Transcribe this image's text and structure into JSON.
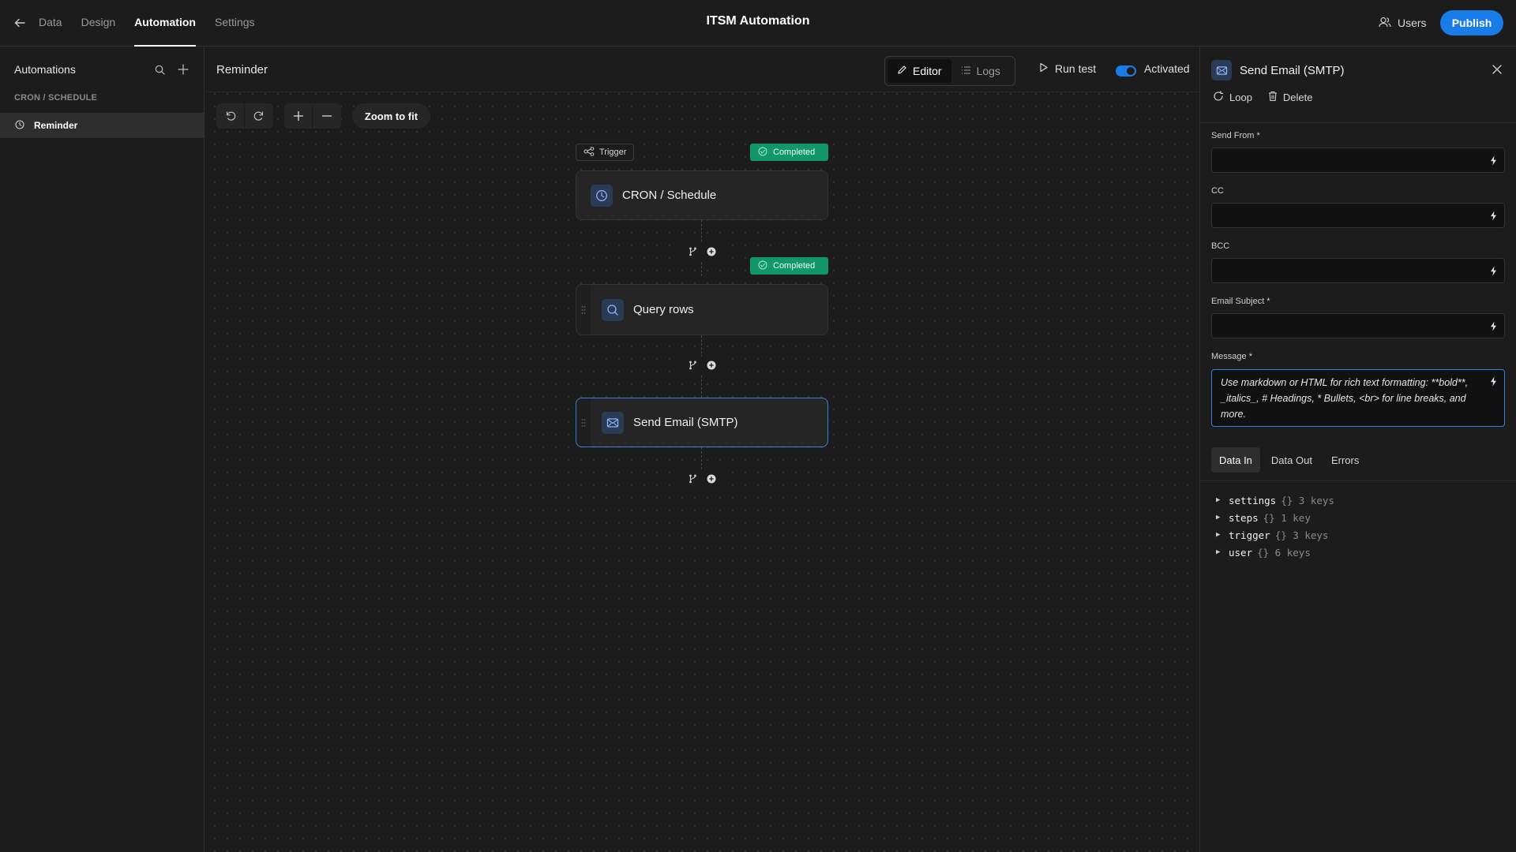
{
  "app": {
    "title": "ITSM Automation",
    "nav": [
      "Data",
      "Design",
      "Automation",
      "Settings"
    ],
    "active_nav": "Automation",
    "users_label": "Users",
    "publish_label": "Publish"
  },
  "sidebar": {
    "title": "Automations",
    "section": "CRON / SCHEDULE",
    "items": [
      {
        "label": "Reminder"
      }
    ]
  },
  "canvas": {
    "automation_name": "Reminder",
    "modes": [
      "Editor",
      "Logs"
    ],
    "active_mode": "Editor",
    "run_test_label": "Run test",
    "activated_label": "Activated",
    "activated": true,
    "zoom_fit_label": "Zoom to fit",
    "trigger_tag": "Trigger",
    "nodes": [
      {
        "label": "CRON / Schedule",
        "status": "Completed",
        "icon": "clock-icon"
      },
      {
        "label": "Query rows",
        "status": "Completed",
        "icon": "search-icon"
      },
      {
        "label": "Send Email (SMTP)",
        "status": "",
        "icon": "mail-icon"
      }
    ]
  },
  "panel": {
    "title": "Send Email (SMTP)",
    "actions": [
      "Loop",
      "Delete"
    ],
    "fields": [
      {
        "label": "Send From *",
        "value": ""
      },
      {
        "label": "CC",
        "value": ""
      },
      {
        "label": "BCC",
        "value": ""
      },
      {
        "label": "Email Subject *",
        "value": ""
      }
    ],
    "message_label": "Message *",
    "message_placeholder": "Use markdown or HTML for rich text formatting: **bold**, _italics_, # Headings, * Bullets, <br> for line breaks, and more.",
    "data_tabs": [
      "Data In",
      "Data Out",
      "Errors"
    ],
    "active_data_tab": "Data In",
    "tree": [
      {
        "key": "settings",
        "meta": "{} 3 keys"
      },
      {
        "key": "steps",
        "meta": "{} 1 key"
      },
      {
        "key": "trigger",
        "meta": "{} 3 keys"
      },
      {
        "key": "user",
        "meta": "{} 6 keys"
      }
    ]
  },
  "colors": {
    "accent": "#1a7ce8",
    "completed": "#12966b",
    "selected_border": "#3b7fd9",
    "background": "#1c1c1c"
  }
}
